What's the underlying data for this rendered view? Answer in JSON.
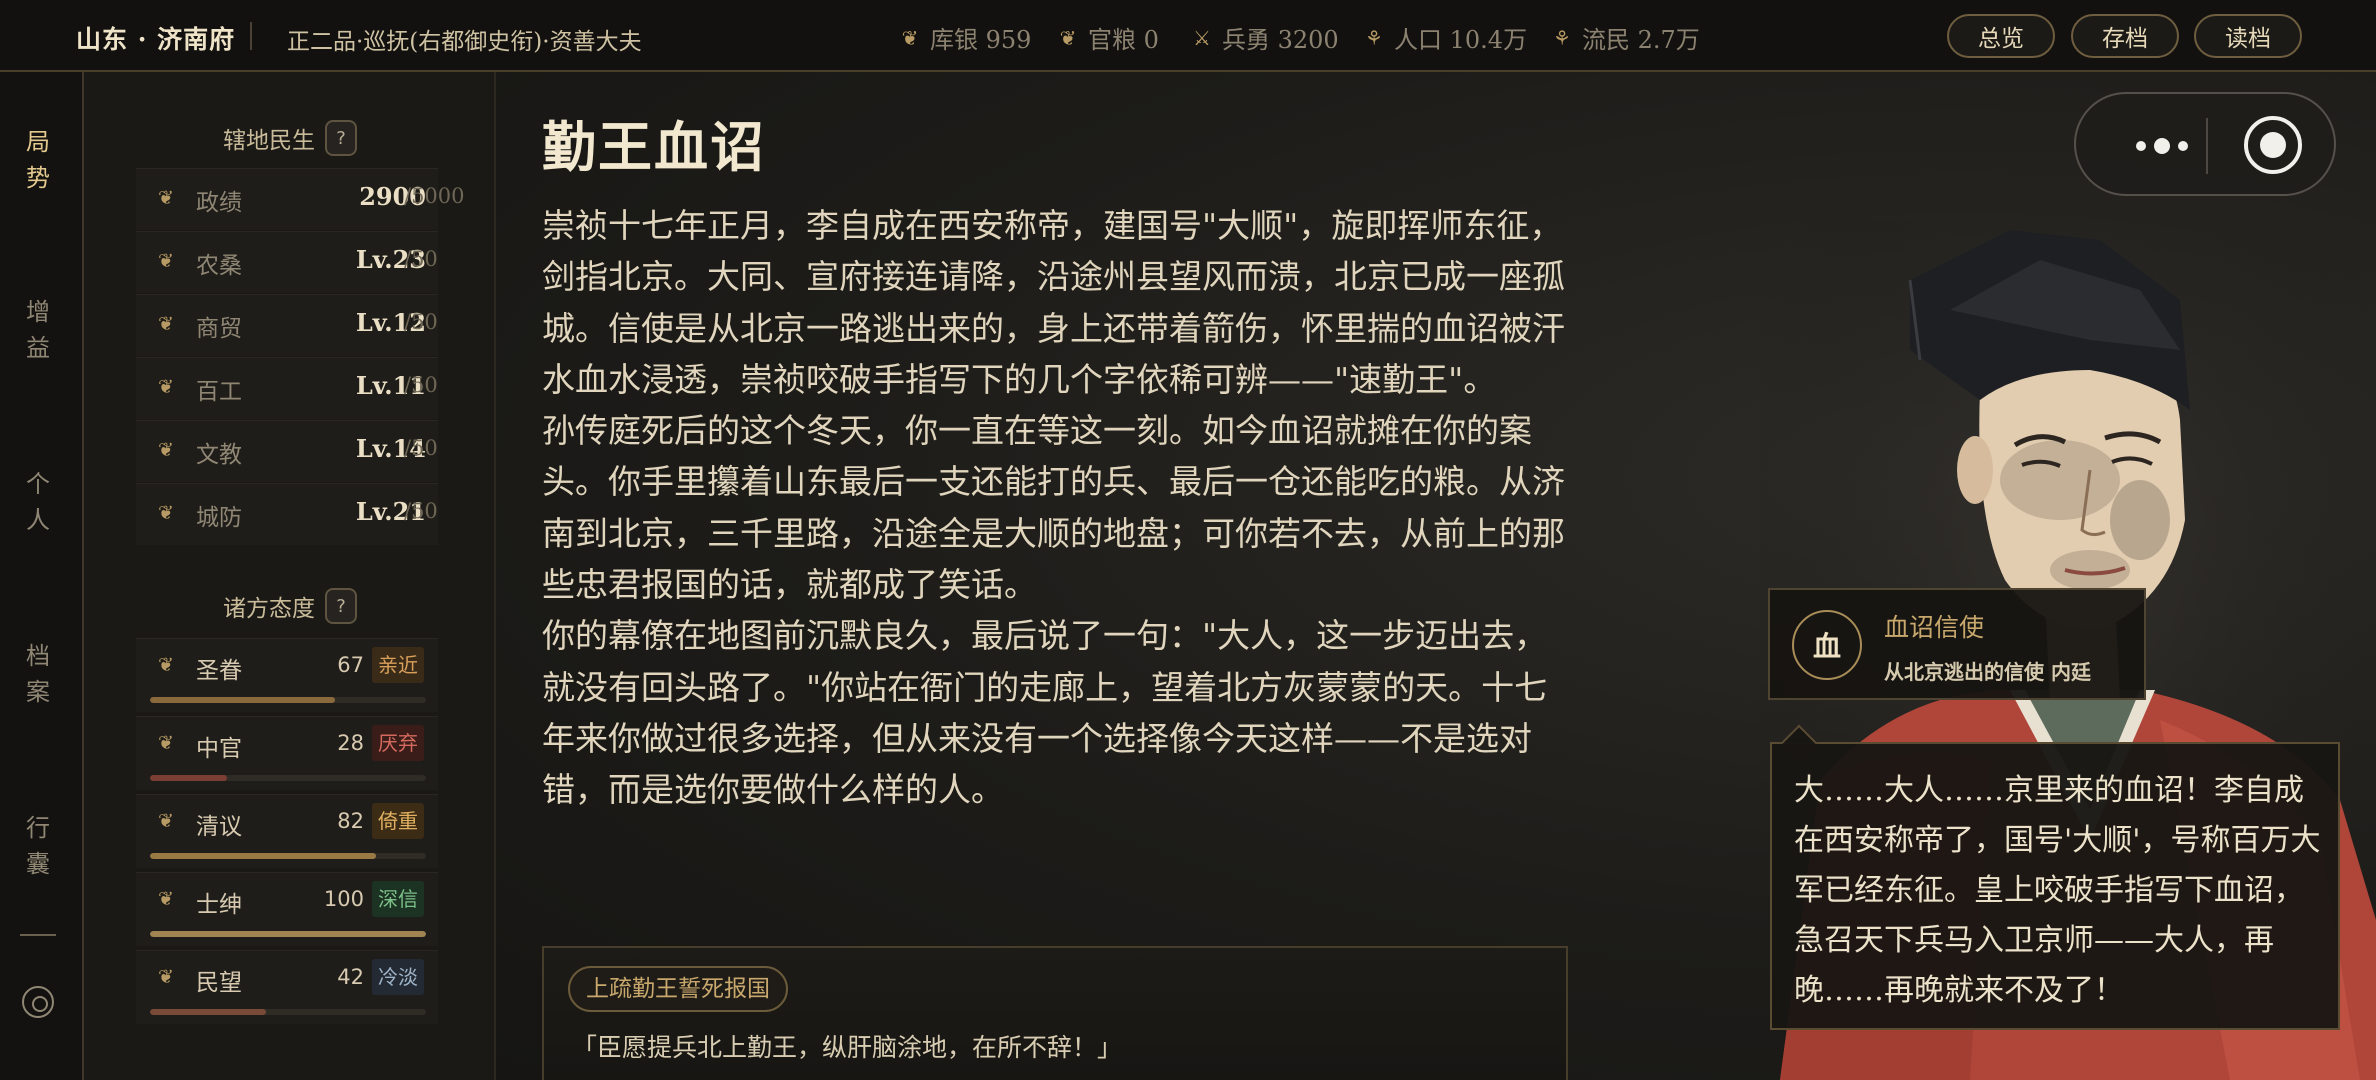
{
  "topbar": {
    "location": "山东 · 济南府",
    "rank": "正二品·巡抚(右都御史衔)·资善大夫",
    "resources": [
      {
        "icon": "silver-icon",
        "label": "库银 959"
      },
      {
        "icon": "grain-icon",
        "label": "官粮 0"
      },
      {
        "icon": "soldier-icon",
        "label": "兵勇 3200"
      },
      {
        "icon": "population-icon",
        "label": "人口 10.4万"
      },
      {
        "icon": "refugee-icon",
        "label": "流民 2.7万"
      }
    ],
    "buttons": {
      "overview": "总览",
      "save": "存档",
      "load": "读档"
    }
  },
  "leftnav": {
    "items": [
      {
        "label": "局势",
        "active": true
      },
      {
        "label": "增益",
        "active": false
      },
      {
        "label": "个人",
        "active": false
      },
      {
        "label": "档案",
        "active": false
      },
      {
        "label": "行囊",
        "active": false
      }
    ]
  },
  "territory": {
    "heading": "辖地民生",
    "help": "?",
    "stats": [
      {
        "icon": "politics-icon",
        "name": "政绩",
        "value": "2900",
        "max": "/5000"
      },
      {
        "icon": "agriculture-icon",
        "name": "农桑",
        "value": "Lv.23",
        "max": "/50"
      },
      {
        "icon": "trade-icon",
        "name": "商贸",
        "value": "Lv.12",
        "max": "/50"
      },
      {
        "icon": "craft-icon",
        "name": "百工",
        "value": "Lv.11",
        "max": "/50"
      },
      {
        "icon": "education-icon",
        "name": "文教",
        "value": "Lv.14",
        "max": "/50"
      },
      {
        "icon": "defense-icon",
        "name": "城防",
        "value": "Lv.21",
        "max": "/50"
      }
    ]
  },
  "attitudes": {
    "heading": "诸方态度",
    "help": "?",
    "items": [
      {
        "icon": "emperor-icon",
        "name": "圣眷",
        "value": "67",
        "tag": "亲近",
        "tag_color": "#d9a05a",
        "tag_bg": "#3a2a18",
        "level": 0.67,
        "bar_color": "#8a6a3c"
      },
      {
        "icon": "eunuch-icon",
        "name": "中官",
        "value": "28",
        "tag": "厌弃",
        "tag_color": "#d46a5e",
        "tag_bg": "#3a1c18",
        "level": 0.28,
        "bar_color": "#7a3e32"
      },
      {
        "icon": "scholar-icon",
        "name": "清议",
        "value": "82",
        "tag": "倚重",
        "tag_color": "#e0b060",
        "tag_bg": "#3c2c16",
        "level": 0.82,
        "bar_color": "#9a7a44"
      },
      {
        "icon": "gentry-icon",
        "name": "士绅",
        "value": "100",
        "tag": "深信",
        "tag_color": "#7cc08a",
        "tag_bg": "#1c3222",
        "level": 1.0,
        "bar_color": "#a08452"
      },
      {
        "icon": "people-icon",
        "name": "民望",
        "value": "42",
        "tag": "冷淡",
        "tag_color": "#9fb3c8",
        "tag_bg": "#232a33",
        "level": 0.42,
        "bar_color": "#7a4a38"
      }
    ]
  },
  "event": {
    "title": "勤王血诏",
    "paragraphs": [
      "崇祯十七年正月，李自成在西安称帝，建国号\"大顺\"，旋即挥师东征，剑指北京。大同、宣府接连请降，沿途州县望风而溃，北京已成一座孤城。信使是从北京一路逃出来的，身上还带着箭伤，怀里揣的血诏被汗水血水浸透，崇祯咬破手指写下的几个字依稀可辨——\"速勤王\"。",
      "孙传庭死后的这个冬天，你一直在等这一刻。如今血诏就摊在你的案头。你手里攥着山东最后一支还能打的兵、最后一仓还能吃的粮。从济南到北京，三千里路，沿途全是大顺的地盘；可你若不去，从前上的那些忠君报国的话，就都成了笑话。",
      "你的幕僚在地图前沉默良久，最后说了一句：\"大人，这一步迈出去，就没有回头路了。\"你站在衙门的走廊上，望着北方灰蒙蒙的天。十七年来你做过很多选择，但从来没有一个选择像今天这样——不是选对错，而是选你要做什么样的人。"
    ],
    "choice": {
      "tag": "上疏勤王誓死报国",
      "quote": "「臣愿提兵北上勤王，纵肝脑涂地，在所不辞！」"
    }
  },
  "speaker": {
    "seal": "血",
    "name": "血诏信使",
    "subtitle": "从北京逃出的信使  内廷"
  },
  "dialogue": {
    "text": "大……大人……京里来的血诏！李自成在西安称帝了，国号'大顺'，号称百万大军已经东征。皇上咬破手指写下血诏，急召天下兵马入卫京师——大人，再晚……再晚就来不及了！"
  }
}
